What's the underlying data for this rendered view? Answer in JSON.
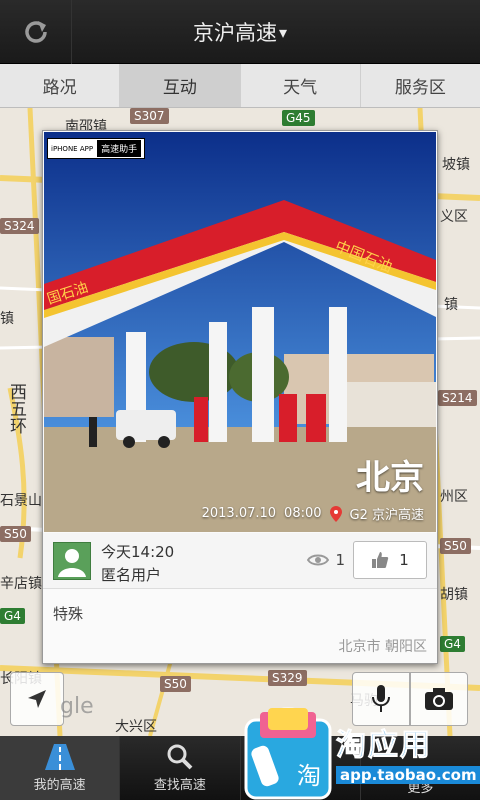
{
  "header": {
    "title": "京沪高速",
    "caret": "▾"
  },
  "tabs": [
    {
      "label": "路况"
    },
    {
      "label": "互动"
    },
    {
      "label": "天气"
    },
    {
      "label": "服务区"
    }
  ],
  "map": {
    "labels": [
      "南邵镇",
      "坡镇",
      "义区",
      "镇",
      "镇",
      "西五环",
      "石景山",
      "辛店镇",
      "州区",
      "胡镇",
      "长阳镇",
      "马驹",
      "大兴区"
    ],
    "shields": [
      "S307",
      "G45",
      "S324",
      "S50",
      "G4",
      "S50",
      "S329",
      "S214",
      "G4",
      "S50"
    ]
  },
  "card": {
    "badge": {
      "left": "iPHONE APP",
      "right": "高速助手"
    },
    "city": "北京",
    "date": "2013.07.10",
    "time": "08:00",
    "road": "G2 京沪高速",
    "post_time": "今天14:20",
    "user": "匿名用户",
    "views": "1",
    "likes": "1",
    "content": "特殊",
    "location": "北京市 朝阳区",
    "sign_text": "中国石油",
    "sign_text_left": "国石油"
  },
  "google_logo": "gle",
  "bottom_nav": [
    {
      "label": "我的高速"
    },
    {
      "label": "查找高速"
    },
    {
      "label": ""
    },
    {
      "label": "更多"
    }
  ],
  "watermark": {
    "name": "淘应用",
    "url": "app.taobao.com"
  },
  "colors": {
    "accent": "#1a8ad8",
    "avatar": "#5aa05a",
    "canopy": "#d81e2a"
  }
}
